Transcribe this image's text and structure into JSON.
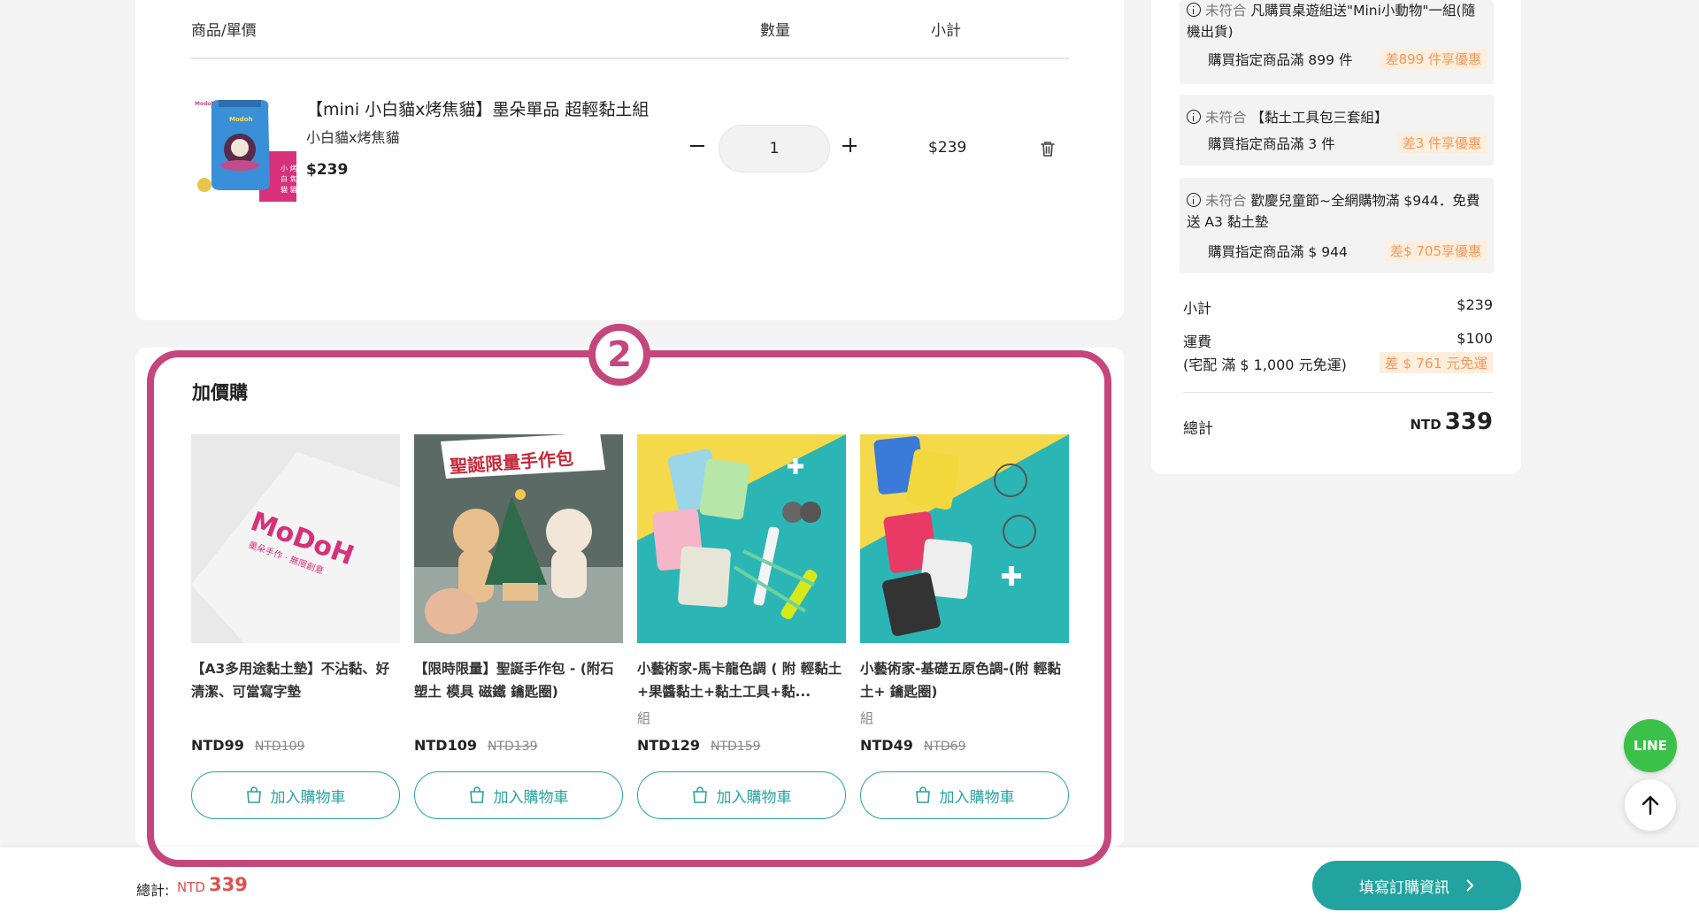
{
  "cart": {
    "header": {
      "product": "商品/單價",
      "quantity": "數量",
      "subtotal": "小計"
    },
    "item": {
      "title": "【mini 小白貓x烤焦貓】墨朵單品 超輕黏土組",
      "variant": "小白貓x烤焦貓",
      "price": "$239",
      "quantity": "1",
      "subtotal": "$239"
    }
  },
  "addon": {
    "step_number": "2",
    "title": "加價購",
    "add_label": "加入購物車",
    "products": [
      {
        "name": "【A3多用途黏土墊】不沾黏、好清潔、可當寫字墊",
        "unit": "",
        "price": "NTD99",
        "original_price": "NTD109",
        "image_text": "MoDoH"
      },
      {
        "name": "【限時限量】聖誕手作包 - (附石塑土 模具 磁鐵 鑰匙圈)",
        "unit": "",
        "price": "NTD109",
        "original_price": "NTD139",
        "image_text": "聖誕限量手作包"
      },
      {
        "name": "小藝術家-馬卡龍色調 ( 附 輕黏土+果醬黏土+黏土工具+黏...",
        "unit": "組",
        "price": "NTD129",
        "original_price": "NTD159"
      },
      {
        "name": "小藝術家-基礎五原色調-(附 輕黏土+ 鑰匙圈)",
        "unit": "組",
        "price": "NTD49",
        "original_price": "NTD69"
      }
    ]
  },
  "summary": {
    "promos": [
      {
        "status": "未符合",
        "title": "凡購買桌遊組送\"Mini小動物\"一組(隨機出貨)",
        "condition": "購買指定商品滿 899 件",
        "tag": "差899 件享優惠"
      },
      {
        "status": "未符合",
        "title": "【黏土工具包三套組】",
        "condition": "購買指定商品滿 3 件",
        "tag": "差3 件享優惠"
      },
      {
        "status": "未符合",
        "title": "歡慶兒童節~全網購物滿 $944．免費送 A3 黏土墊",
        "condition": "購買指定商品滿 $ 944",
        "tag": "差$ 705享優惠"
      }
    ],
    "subtotal_label": "小計",
    "subtotal_value": "$239",
    "shipping_label": "運費",
    "shipping_value": "$100",
    "shipping_note": "(宅配 滿 $ 1,000 元免運)",
    "shipping_tag": "差 $ 761 元免運",
    "total_label": "總計",
    "total_currency": "NTD",
    "total_value": "339"
  },
  "bottom_bar": {
    "total_label": "總計:",
    "currency": "NTD",
    "total": "339",
    "checkout_label": "填寫訂購資訊"
  },
  "floating": {
    "line_label": "LINE"
  },
  "colors": {
    "accent_teal": "#23a39f",
    "highlight_magenta": "#c5467c",
    "tag_orange": "#f1995c",
    "total_red": "#e0504f",
    "line_green": "#3bc14a"
  }
}
